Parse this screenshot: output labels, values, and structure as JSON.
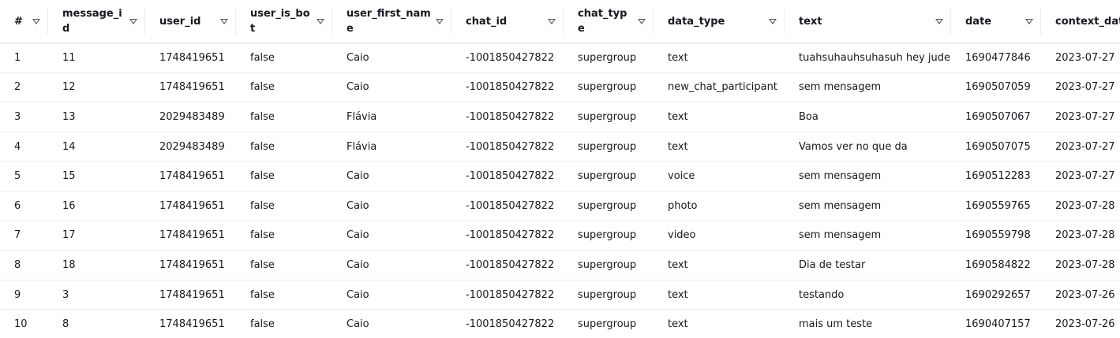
{
  "columns": [
    {
      "key": "index",
      "label": "#"
    },
    {
      "key": "message_id",
      "label": "message_id"
    },
    {
      "key": "user_id",
      "label": "user_id"
    },
    {
      "key": "user_is_bot",
      "label": "user_is_bot"
    },
    {
      "key": "user_first_name",
      "label": "user_first_name"
    },
    {
      "key": "chat_id",
      "label": "chat_id"
    },
    {
      "key": "chat_type",
      "label": "chat_type"
    },
    {
      "key": "data_type",
      "label": "data_type"
    },
    {
      "key": "text",
      "label": "text"
    },
    {
      "key": "date",
      "label": "date"
    },
    {
      "key": "context_date",
      "label": "context_date"
    }
  ],
  "rows": [
    [
      "1",
      "11",
      "1748419651",
      "false",
      "Caio",
      "-1001850427822",
      "supergroup",
      "text",
      "tuahsuhauhsuhasuh hey jude",
      "1690477846",
      "2023-07-27"
    ],
    [
      "2",
      "12",
      "1748419651",
      "false",
      "Caio",
      "-1001850427822",
      "supergroup",
      "new_chat_participant",
      "sem mensagem",
      "1690507059",
      "2023-07-27"
    ],
    [
      "3",
      "13",
      "2029483489",
      "false",
      "Flávia",
      "-1001850427822",
      "supergroup",
      "text",
      "Boa",
      "1690507067",
      "2023-07-27"
    ],
    [
      "4",
      "14",
      "2029483489",
      "false",
      "Flávia",
      "-1001850427822",
      "supergroup",
      "text",
      "Vamos ver no que da",
      "1690507075",
      "2023-07-27"
    ],
    [
      "5",
      "15",
      "1748419651",
      "false",
      "Caio",
      "-1001850427822",
      "supergroup",
      "voice",
      "sem mensagem",
      "1690512283",
      "2023-07-27"
    ],
    [
      "6",
      "16",
      "1748419651",
      "false",
      "Caio",
      "-1001850427822",
      "supergroup",
      "photo",
      "sem mensagem",
      "1690559765",
      "2023-07-28"
    ],
    [
      "7",
      "17",
      "1748419651",
      "false",
      "Caio",
      "-1001850427822",
      "supergroup",
      "video",
      "sem mensagem",
      "1690559798",
      "2023-07-28"
    ],
    [
      "8",
      "18",
      "1748419651",
      "false",
      "Caio",
      "-1001850427822",
      "supergroup",
      "text",
      "Dia de testar",
      "1690584822",
      "2023-07-28"
    ],
    [
      "9",
      "3",
      "1748419651",
      "false",
      "Caio",
      "-1001850427822",
      "supergroup",
      "text",
      "testando",
      "1690292657",
      "2023-07-26"
    ],
    [
      "10",
      "8",
      "1748419651",
      "false",
      "Caio",
      "-1001850427822",
      "supergroup",
      "text",
      "mais um teste",
      "1690407157",
      "2023-07-26"
    ]
  ]
}
